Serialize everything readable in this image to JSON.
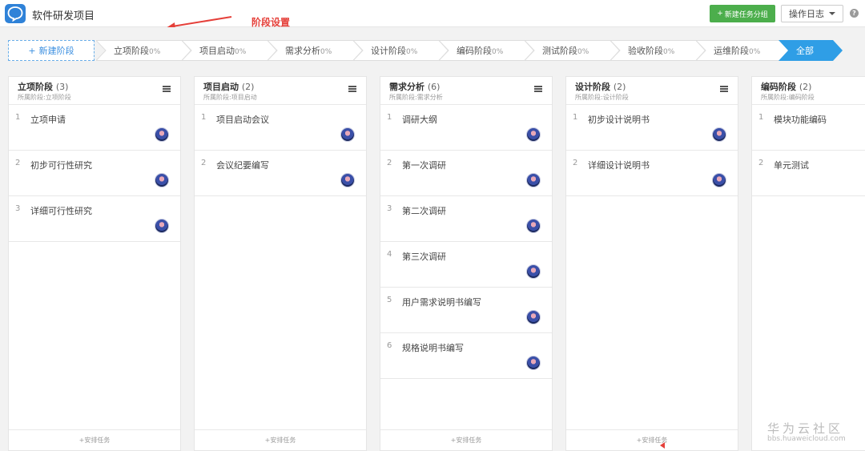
{
  "header": {
    "project_title": "软件研发项目",
    "annotation": "阶段设置",
    "new_group_label": "新建任务分组",
    "log_label": "操作日志",
    "help_icon": "?"
  },
  "stages": {
    "new_label": "新建阶段",
    "items": [
      {
        "label": "立项阶段",
        "pct": "0%"
      },
      {
        "label": "项目启动",
        "pct": "0%"
      },
      {
        "label": "需求分析",
        "pct": "0%"
      },
      {
        "label": "设计阶段",
        "pct": "0%"
      },
      {
        "label": "编码阶段",
        "pct": "0%"
      },
      {
        "label": "测试阶段",
        "pct": "0%"
      },
      {
        "label": "验收阶段",
        "pct": "0%"
      },
      {
        "label": "运维阶段",
        "pct": "0%"
      }
    ],
    "all_label": "全部"
  },
  "columns": [
    {
      "title": "立项阶段",
      "count": "(3)",
      "sub": "所属阶段:立项阶段",
      "tasks": [
        {
          "n": "1",
          "name": "立项申请"
        },
        {
          "n": "2",
          "name": "初步可行性研究"
        },
        {
          "n": "3",
          "name": "详细可行性研究"
        }
      ]
    },
    {
      "title": "项目启动",
      "count": "(2)",
      "sub": "所属阶段:项目启动",
      "tasks": [
        {
          "n": "1",
          "name": "项目启动会议"
        },
        {
          "n": "2",
          "name": "会议纪要编写"
        }
      ]
    },
    {
      "title": "需求分析",
      "count": "(6)",
      "sub": "所属阶段:需求分析",
      "tasks": [
        {
          "n": "1",
          "name": "调研大纲"
        },
        {
          "n": "2",
          "name": "第一次调研"
        },
        {
          "n": "3",
          "name": "第二次调研"
        },
        {
          "n": "4",
          "name": "第三次调研"
        },
        {
          "n": "5",
          "name": "用户需求说明书编写"
        },
        {
          "n": "6",
          "name": "规格说明书编写"
        }
      ]
    },
    {
      "title": "设计阶段",
      "count": "(2)",
      "sub": "所属阶段:设计阶段",
      "tasks": [
        {
          "n": "1",
          "name": "初步设计说明书"
        },
        {
          "n": "2",
          "name": "详细设计说明书"
        }
      ]
    },
    {
      "title": "编码阶段",
      "count": "(2)",
      "sub": "所属阶段:编码阶段",
      "tasks": [
        {
          "n": "1",
          "name": "模块功能编码"
        },
        {
          "n": "2",
          "name": "单元测试"
        }
      ]
    }
  ],
  "footer_label": "安排任务",
  "watermark": {
    "big": "华为云社区",
    "small": "bbs.huaweicloud.com"
  },
  "colors": {
    "accent": "#2f9ee6",
    "green": "#4cae4c",
    "annotation": "#e5403a",
    "logo": "#2f82d8"
  }
}
